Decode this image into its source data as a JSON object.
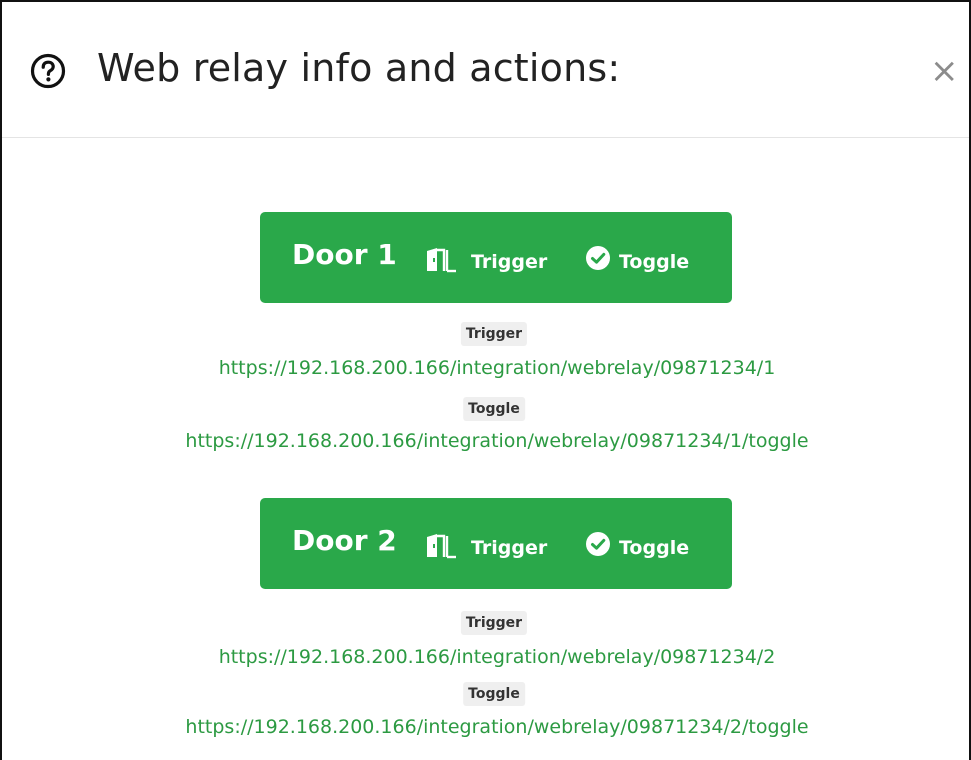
{
  "modal": {
    "title": "Web relay info and actions:",
    "close_label": "×"
  },
  "doors": [
    {
      "name": "Door 1",
      "trigger_label": "Trigger",
      "toggle_label": "Toggle",
      "trigger_url_label": "Trigger",
      "trigger_url": "https://192.168.200.166/integration/webrelay/09871234/1",
      "toggle_url_label": "Toggle",
      "toggle_url": "https://192.168.200.166/integration/webrelay/09871234/1/toggle"
    },
    {
      "name": "Door 2",
      "trigger_label": "Trigger",
      "toggle_label": "Toggle",
      "trigger_url_label": "Trigger",
      "trigger_url": "https://192.168.200.166/integration/webrelay/09871234/2",
      "toggle_url_label": "Toggle",
      "toggle_url": "https://192.168.200.166/integration/webrelay/09871234/2/toggle"
    }
  ],
  "colors": {
    "button_green": "#2aa84a",
    "link_green": "#2c9a42"
  },
  "icons": {
    "help": "question-circle-icon",
    "trigger": "door-open-icon",
    "toggle": "check-circle-icon",
    "close": "close-icon"
  }
}
